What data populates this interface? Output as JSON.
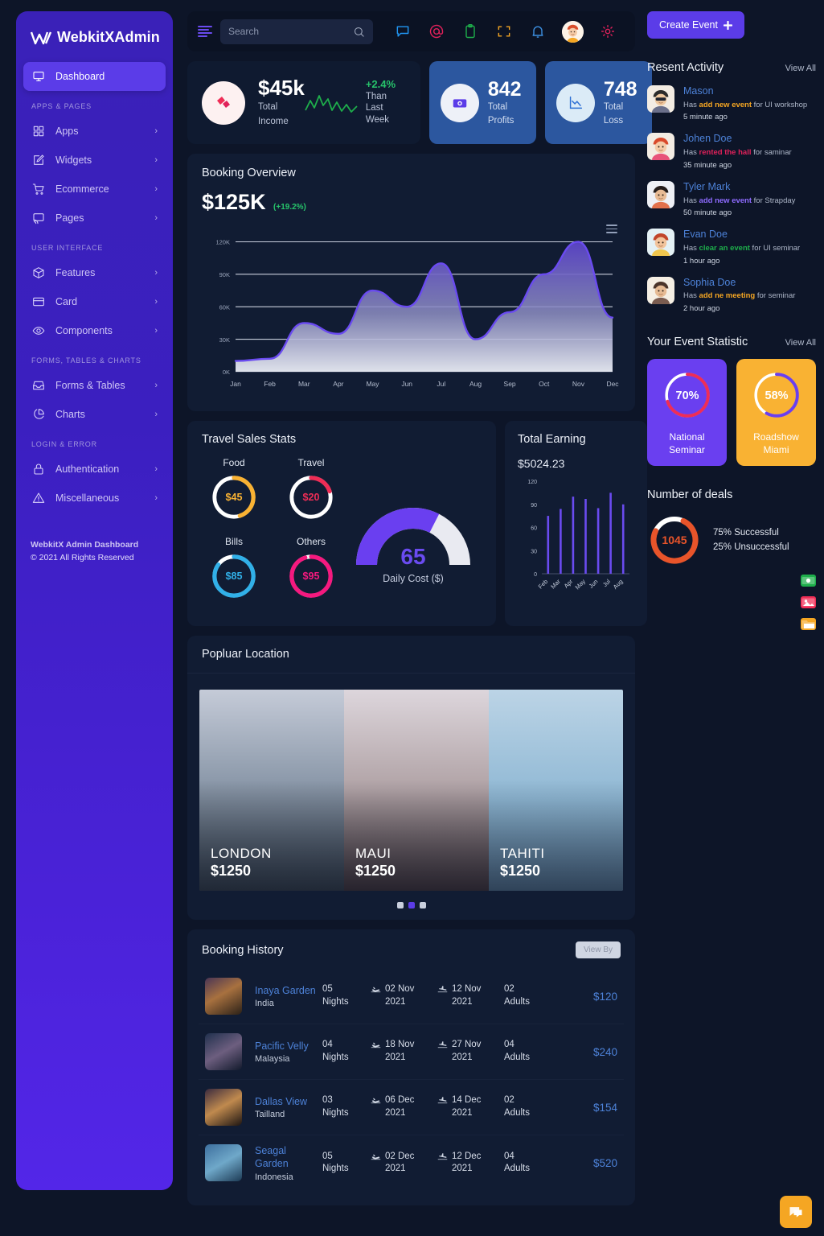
{
  "brand": {
    "mark": "W",
    "name": "WebkitXAdmin"
  },
  "sidebar": {
    "active": "Dashboard",
    "items": [
      {
        "label": "Dashboard",
        "icon": "monitor-icon",
        "active": true,
        "chevron": ""
      },
      {
        "label": "Apps",
        "icon": "grid-icon",
        "chevron": "›"
      },
      {
        "label": "Widgets",
        "icon": "edit-square-icon",
        "chevron": "›"
      },
      {
        "label": "Ecommerce",
        "icon": "cart-icon",
        "chevron": "›"
      },
      {
        "label": "Pages",
        "icon": "cast-icon",
        "chevron": "›"
      },
      {
        "label": "Features",
        "icon": "box-icon",
        "chevron": "›"
      },
      {
        "label": "Card",
        "icon": "credit-card-icon",
        "chevron": "›"
      },
      {
        "label": "Components",
        "icon": "eye-icon",
        "chevron": "›"
      },
      {
        "label": "Forms & Tables",
        "icon": "inbox-icon",
        "chevron": "›"
      },
      {
        "label": "Charts",
        "icon": "pie-chart-icon",
        "chevron": "›"
      },
      {
        "label": "Authentication",
        "icon": "lock-icon",
        "chevron": "›"
      },
      {
        "label": "Miscellaneous",
        "icon": "alert-triangle-icon",
        "chevron": "›"
      }
    ],
    "sections": [
      {
        "label": "APPS & PAGES",
        "before": "Apps"
      },
      {
        "label": "USER INTERFACE",
        "before": "Features"
      },
      {
        "label": "FORMS, TABLES & CHARTS",
        "before": "Forms & Tables"
      },
      {
        "label": "LOGIN & ERROR",
        "before": "Authentication"
      }
    ],
    "footer_line1": "WebkitX Admin Dashboard",
    "footer_line2": "© 2021 All Rights Reserved"
  },
  "topbar": {
    "menu_icon": "hamburger-icon",
    "search_placeholder": "Search",
    "search_value": "",
    "icons": [
      {
        "name": "chat-icon",
        "color": "#2196f3"
      },
      {
        "name": "at-mention-icon",
        "color": "#e0215a"
      },
      {
        "name": "clipboard-icon",
        "color": "#1eae4b"
      },
      {
        "name": "fullscreen-icon",
        "color": "#f5a623"
      },
      {
        "name": "bell-icon",
        "color": "#3c8fe0"
      },
      {
        "name": "settings-gear-icon",
        "color": "#e0215a"
      }
    ],
    "avatar": "user-avatar"
  },
  "stats": {
    "income": {
      "value": "$45k",
      "label_line1": "Total",
      "label_line2": "Income",
      "change": "+2.4%",
      "note_line1": "Than",
      "note_line2": "Last",
      "note_line3": "Week",
      "icon": "ticket-icon",
      "change_color": "#27c46b"
    },
    "profits": {
      "value": "842",
      "label_line1": "Total",
      "label_line2": "Profits",
      "icon": "money-camera-icon",
      "bg": "#2c579f"
    },
    "loss": {
      "value": "748",
      "label_line1": "Total",
      "label_line2": "Loss",
      "icon": "chart-down-icon",
      "bg": "#2c579f"
    }
  },
  "booking_overview": {
    "title": "Booking Overview",
    "amount": "$125K",
    "percent": "(+19.2%)",
    "menu_icon": "hamburger-menu-icon"
  },
  "travel_stats": {
    "title": "Travel Sales Stats",
    "donuts": [
      {
        "label": "Food",
        "value": "$45",
        "color": "#f9b233",
        "pct": 45
      },
      {
        "label": "Travel",
        "value": "$20",
        "color": "#ef2d56",
        "pct": 20
      },
      {
        "label": "Bills",
        "value": "$85",
        "color": "#31b0e8",
        "pct": 85
      },
      {
        "label": "Others",
        "value": "$95",
        "color": "#f5197f",
        "pct": 95
      }
    ],
    "gauge": {
      "value": "65",
      "label": "Daily Cost ($)",
      "pct": 65,
      "color": "#6a3ff0"
    }
  },
  "total_earning": {
    "title": "Total Earning",
    "amount": "$5024.23"
  },
  "popular_location": {
    "title": "Popluar Location",
    "cards": [
      {
        "city": "LONDON",
        "price": "$1250"
      },
      {
        "city": "MAUI",
        "price": "$1250"
      },
      {
        "city": "TAHITI",
        "price": "$1250"
      }
    ],
    "dots": [
      false,
      true,
      false
    ]
  },
  "booking_history": {
    "title": "Booking History",
    "view_by": "View By",
    "rows": [
      {
        "name": "Inaya Garden",
        "country": "India",
        "nights": "05",
        "nights_unit": "Nights",
        "depart": "02 Nov",
        "depart_year": "2021",
        "arrive": "12 Nov",
        "arrive_year": "2021",
        "guests": "02",
        "guests_unit": "Adults",
        "amount": "$120"
      },
      {
        "name": "Pacific Velly",
        "country": "Malaysia",
        "nights": "04",
        "nights_unit": "Nights",
        "depart": "18 Nov",
        "depart_year": "2021",
        "arrive": "27 Nov",
        "arrive_year": "2021",
        "guests": "04",
        "guests_unit": "Adults",
        "amount": "$240"
      },
      {
        "name": "Dallas View",
        "country": "Tailland",
        "nights": "03",
        "nights_unit": "Nights",
        "depart": "06 Dec",
        "depart_year": "2021",
        "arrive": "14 Dec",
        "arrive_year": "2021",
        "guests": "02",
        "guests_unit": "Adults",
        "amount": "$154"
      },
      {
        "name": "Seagal Garden",
        "country": "Indonesia",
        "nights": "05",
        "nights_unit": "Nights",
        "depart": "02 Dec",
        "depart_year": "2021",
        "arrive": "12 Dec",
        "arrive_year": "2021",
        "guests": "04",
        "guests_unit": "Adults",
        "amount": "$520"
      }
    ]
  },
  "right_panel": {
    "create_event": "Create Event",
    "create_event_icon": "plus-icon",
    "activity": {
      "title": "Resent Activity",
      "view_all": "View All",
      "items": [
        {
          "name": "Mason",
          "pre": "Has ",
          "bold": "add new event",
          "post": " for UI workshop",
          "time": "5 minute ago",
          "bold_color": "#f5a623"
        },
        {
          "name": "Johen Doe",
          "pre": "Has ",
          "bold": "rented the hall",
          "post": " for saminar",
          "time": "35 minute ago",
          "bold_color": "#e0215a"
        },
        {
          "name": "Tyler Mark",
          "pre": "Has ",
          "bold": "add new event",
          "post": " for Strapday",
          "time": "50 minute ago",
          "bold_color": "#8e6bff"
        },
        {
          "name": "Evan Doe",
          "pre": "Has ",
          "bold": "clear an event",
          "post": " for UI seminar",
          "time": "1 hour ago",
          "bold_color": "#1eae4b"
        },
        {
          "name": "Sophia Doe",
          "pre": "Has ",
          "bold": "add ne meeting",
          "post": " for seminar",
          "time": "2 hour ago",
          "bold_color": "#f5a623"
        }
      ]
    },
    "event_statistic": {
      "title": "Your Event Statistic",
      "view_all": "View All",
      "cards": [
        {
          "percent": "70%",
          "pct": 70,
          "label_line1": "National",
          "label_line2": "Seminar",
          "bg": "#6a3ff0",
          "ring": "#ef2d56"
        },
        {
          "percent": "58%",
          "pct": 58,
          "label_line1": "Roadshow",
          "label_line2": "Miami",
          "bg": "#f9b233",
          "ring": "#6a3ff0"
        }
      ]
    },
    "deals": {
      "title": "Number of deals",
      "value": "1045",
      "pct": 75,
      "color": "#e8542a",
      "line1": "75% Successful",
      "line2": "25% Unsuccessful"
    },
    "badges": [
      {
        "name": "money-badge-icon",
        "color": "#1eae4b"
      },
      {
        "name": "image-badge-icon",
        "color": "#ef2d56"
      },
      {
        "name": "folder-badge-icon",
        "color": "#f5a623"
      }
    ]
  },
  "fab": {
    "icon": "chat-bubble-icon",
    "color": "#f5a623"
  },
  "chart_data": [
    {
      "type": "area",
      "title": "Booking Overview",
      "categories": [
        "Jan",
        "Feb",
        "Mar",
        "Apr",
        "May",
        "Jun",
        "Jul",
        "Aug",
        "Sep",
        "Oct",
        "Nov",
        "Dec"
      ],
      "values": [
        10000,
        12000,
        45000,
        35000,
        75000,
        60000,
        100000,
        30000,
        55000,
        90000,
        120000,
        50000
      ],
      "ytick_labels": [
        "0K",
        "30K",
        "60K",
        "90K",
        "120K"
      ],
      "yticks": [
        0,
        30000,
        60000,
        90000,
        120000
      ],
      "ylim": [
        0,
        130000
      ],
      "xlabel": "",
      "ylabel": "",
      "grid": true,
      "legend": "none",
      "line_color": "#6a4bf0",
      "fill": "gradient-purple-to-white"
    },
    {
      "type": "bar",
      "title": "Total Earning",
      "categories": [
        "Feb",
        "Mar",
        "Apr",
        "May",
        "Jun",
        "Jul",
        "Aug"
      ],
      "values": [
        75,
        84,
        100,
        97,
        85,
        105,
        90
      ],
      "ytick_labels": [
        "0",
        "30",
        "60",
        "90",
        "120"
      ],
      "yticks": [
        0,
        30,
        60,
        90,
        120
      ],
      "ylim": [
        0,
        120
      ],
      "xlabel": "",
      "ylabel": "",
      "grid": false,
      "legend": "none",
      "bar_color": "#6a4bf0"
    },
    {
      "type": "pie",
      "title": "Travel Sales Stats",
      "categories": [
        "Food",
        "Travel",
        "Bills",
        "Others"
      ],
      "values": [
        45,
        20,
        85,
        95
      ],
      "labels": [
        "$45",
        "$20",
        "$85",
        "$95"
      ],
      "colors": [
        "#f9b233",
        "#ef2d56",
        "#31b0e8",
        "#f5197f"
      ],
      "legend": "none"
    },
    {
      "type": "pie",
      "title": "Daily Cost ($)",
      "categories": [
        "Used",
        "Remaining"
      ],
      "values": [
        65,
        35
      ],
      "labels": [
        "65",
        ""
      ],
      "colors": [
        "#6a3ff0",
        "#e8e8ee"
      ],
      "legend": "none"
    },
    {
      "type": "pie",
      "title": "National Seminar",
      "categories": [
        "Complete",
        "Remaining"
      ],
      "values": [
        70,
        30
      ],
      "labels": [
        "70%",
        ""
      ],
      "colors": [
        "#ef2d56",
        "#ffffff"
      ],
      "legend": "none"
    },
    {
      "type": "pie",
      "title": "Roadshow Miami",
      "categories": [
        "Complete",
        "Remaining"
      ],
      "values": [
        58,
        42
      ],
      "labels": [
        "58%",
        ""
      ],
      "colors": [
        "#6a3ff0",
        "#ffffff"
      ],
      "legend": "none"
    },
    {
      "type": "pie",
      "title": "Number of deals",
      "categories": [
        "Successful",
        "Unsuccessful"
      ],
      "values": [
        75,
        25
      ],
      "labels": [
        "1045",
        ""
      ],
      "colors": [
        "#e8542a",
        "#ffffff"
      ],
      "legend": "none"
    }
  ]
}
